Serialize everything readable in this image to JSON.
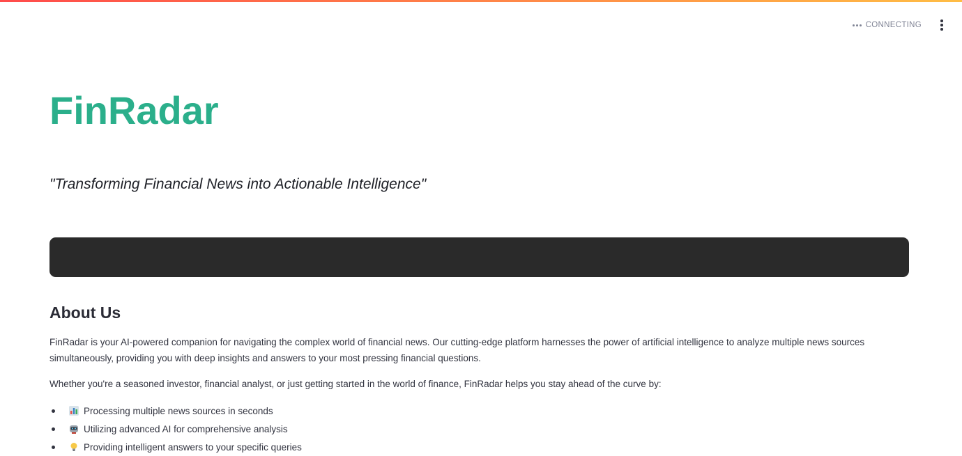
{
  "header": {
    "status_text": "CONNECTING",
    "menu_icon": "more-vertical-icon"
  },
  "hero": {
    "title": "FinRadar",
    "tagline": "\"Transforming Financial News into Actionable Intelligence\""
  },
  "about": {
    "heading": "About Us",
    "paragraph1": "FinRadar is your AI-powered companion for navigating the complex world of financial news. Our cutting-edge platform harnesses the power of artificial intelligence to analyze multiple news sources simultaneously, providing you with deep insights and answers to your most pressing financial questions.",
    "paragraph2": "Whether you're a seasoned investor, financial analyst, or just getting started in the world of finance, FinRadar helps you stay ahead of the curve by:",
    "features": [
      {
        "icon": "bar-chart-icon",
        "text": "Processing multiple news sources in seconds"
      },
      {
        "icon": "robot-icon",
        "text": "Utilizing advanced AI for comprehensive analysis"
      },
      {
        "icon": "lightbulb-icon",
        "text": "Providing intelligent answers to your specific queries"
      }
    ]
  },
  "colors": {
    "brand": "#2baf8b",
    "dark_box": "#2a2a2a",
    "text": "#31333f"
  }
}
